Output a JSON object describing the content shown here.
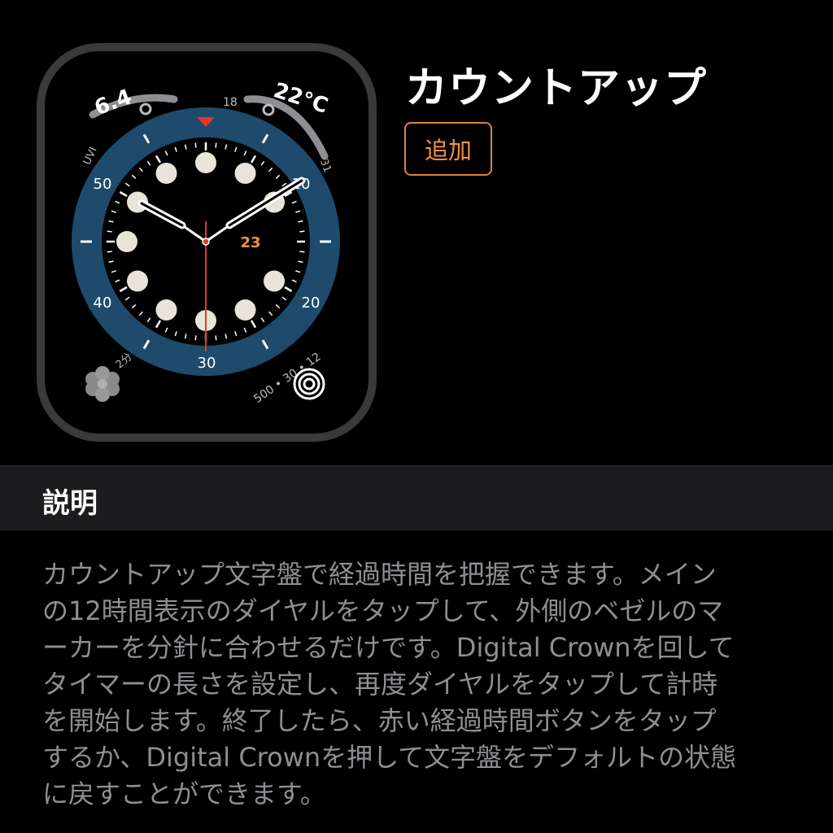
{
  "face": {
    "title": "カウントアップ",
    "add_label": "追加",
    "complications": {
      "uv_value": "6.4",
      "uv_label": "UVI",
      "temp_value": "22°C",
      "temp_low": "18",
      "temp_high": "31",
      "center_date": "23",
      "timer_label": "2分",
      "activity_text": "500 • 30 • 12",
      "breathe_icon": "flower-icon",
      "activity_icon": "activity-rings-icon"
    },
    "bezel_labels": [
      "10",
      "20",
      "30",
      "40",
      "50"
    ],
    "colors": {
      "bezel": "#1e4a6b",
      "accent": "#e0823a",
      "second_hand": "#e0372f",
      "marker": "#e8342e"
    }
  },
  "description": {
    "header": "説明",
    "lines": [
      "カウントアップ文字盤で経過時間を把握できます。メイン",
      "の12時間表示のダイヤルをタップして、外側のベゼルのマ",
      "ーカーを分針に合わせるだけです。Digital Crownを回して",
      "タイマーの長さを設定し、再度ダイヤルをタップして計時",
      "を開始します。終了したら、赤い経過時間ボタンをタップ",
      "するか、Digital Crownを押して文字盤をデフォルトの状態",
      "に戻すことができます。"
    ]
  }
}
